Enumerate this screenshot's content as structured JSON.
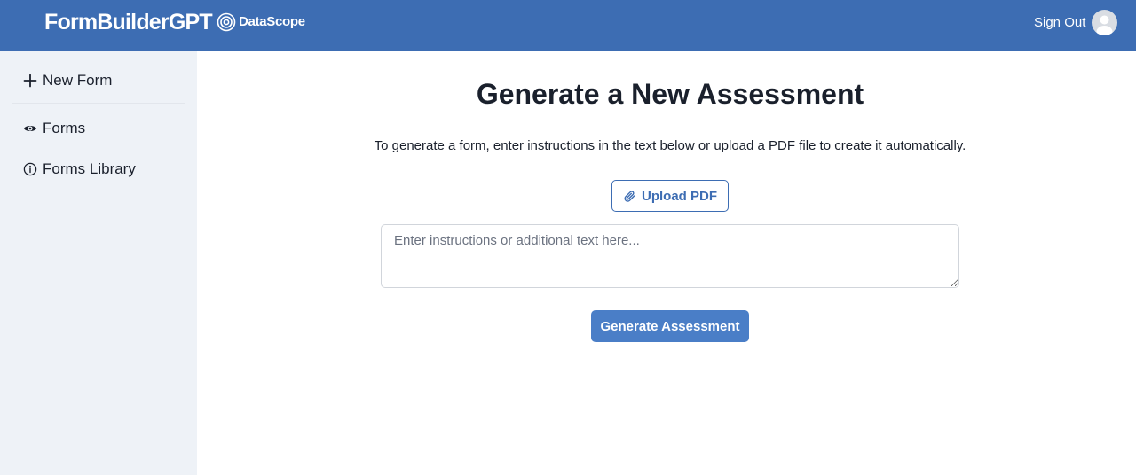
{
  "header": {
    "app_title": "FormBuilderGPT",
    "brand_name": "DataScope",
    "brand_icon": "datascope-logo-icon",
    "signout_label": "Sign Out",
    "avatar_icon": "user-avatar-icon",
    "background_color": "#3d6db3"
  },
  "sidebar": {
    "items": [
      {
        "label": "New Form",
        "icon": "plus-icon"
      },
      {
        "label": "Forms",
        "icon": "eye-icon"
      },
      {
        "label": "Forms Library",
        "icon": "info-icon"
      }
    ],
    "background_color": "#eef2f7"
  },
  "main": {
    "heading": "Generate a New Assessment",
    "description": "To generate a form, enter instructions in the text below or upload a PDF file to create it automatically.",
    "upload_label": "Upload PDF",
    "upload_icon": "paperclip-icon",
    "instructions_value": "",
    "instructions_placeholder": "Enter instructions or additional text here...",
    "generate_label": "Generate Assessment",
    "accent_color": "#4a7ec7"
  }
}
